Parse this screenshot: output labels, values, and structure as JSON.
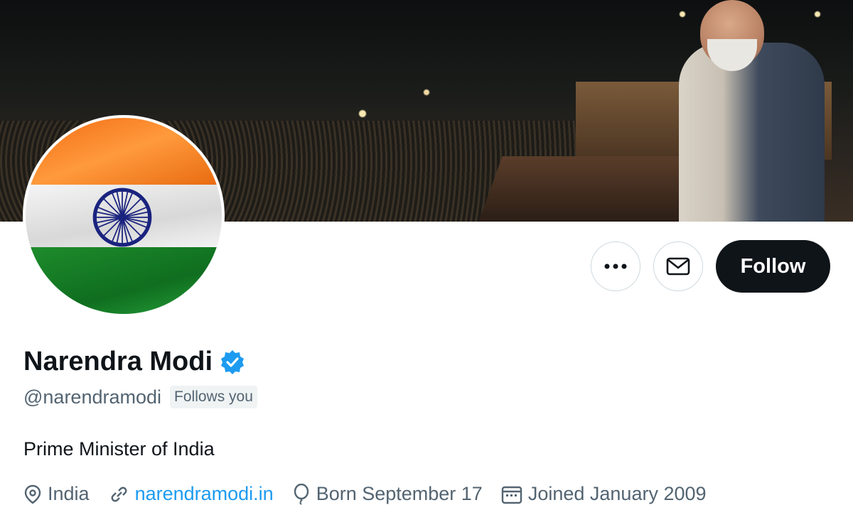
{
  "profile": {
    "name": "Narendra Modi",
    "handle": "@narendramodi",
    "follows_you_badge": "Follows you",
    "bio": "Prime Minister of India",
    "location": "India",
    "website": "narendramodi.in",
    "birthday": "Born September 17",
    "joined": "Joined January 2009"
  },
  "actions": {
    "more_label": "More",
    "message_label": "Message",
    "follow_label": "Follow"
  },
  "icons": {
    "more": "more-dots-icon",
    "message": "envelope-icon",
    "verified": "verified-badge-icon",
    "location": "location-pin-icon",
    "link": "link-icon",
    "birthday": "balloon-icon",
    "calendar": "calendar-icon"
  },
  "colors": {
    "follow_button_bg": "#0f1419",
    "verified_blue": "#1d9bf0",
    "secondary_text": "#536471",
    "link": "#1d9bf0"
  }
}
